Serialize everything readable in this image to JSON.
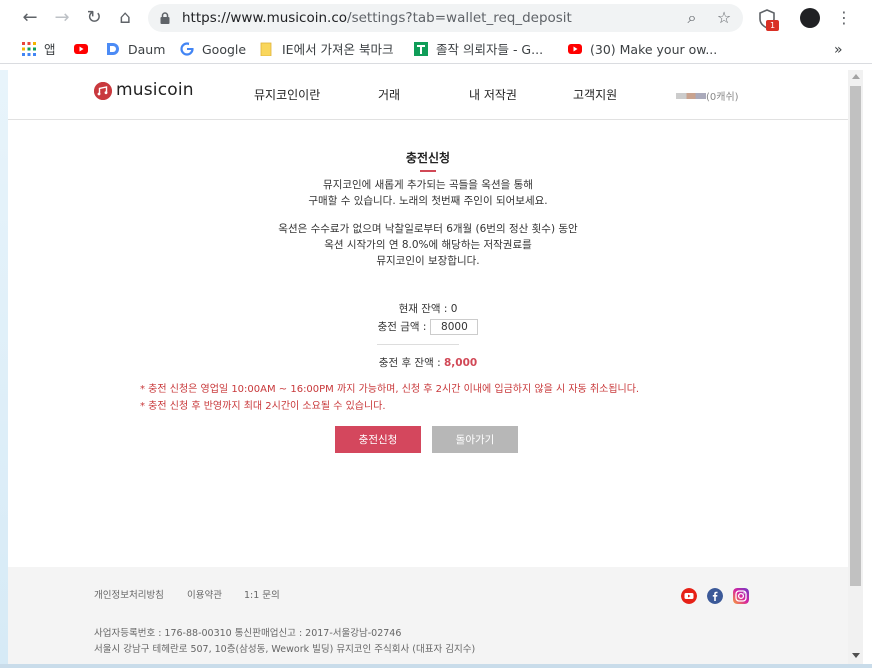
{
  "browser": {
    "url_host": "https://www.musicoin.co",
    "url_path": "/settings?tab=wallet_req_deposit",
    "extension_badge": "1",
    "bookmarks": [
      {
        "label": "앱"
      },
      {
        "label": ""
      },
      {
        "label": "Daum"
      },
      {
        "label": "Google"
      },
      {
        "label": "IE에서 가져온 북마크"
      },
      {
        "label": "졸작 의뢰자들 - G..."
      },
      {
        "label": "(30) Make your ow..."
      }
    ],
    "more_bookmarks": "»"
  },
  "site": {
    "logo_text": "musicoin",
    "nav": [
      "뮤지코인이란",
      "거래",
      "내 저작권",
      "고객지원"
    ],
    "cash_label": "(0캐쉬)"
  },
  "deposit": {
    "title": "충전신청",
    "desc1": [
      "뮤지코인에 새롭게 추가되는 곡들을 옥션을 통해",
      "구매할 수 있습니다. 노래의 첫번째 주인이 되어보세요."
    ],
    "desc2": [
      "옥션은 수수료가 없으며 낙찰일로부터 6개월 (6번의 정산 횟수) 동안",
      "옥션 시작가의 연 8.0%에 해당하는 저작권료를",
      "뮤지코인이 보장합니다."
    ],
    "balance_label": "현재 잔액 : 0",
    "amount_label": "충전 금액 :",
    "amount_value": "8000",
    "after_label": "충전 후 잔액 : ",
    "after_value": "8,000",
    "notice1": "* 충전 신청은 영업일 10:00AM ~ 16:00PM 까지 가능하며, 신청 후 2시간 이내에 입금하지 않을 시 자동 취소됩니다.",
    "notice2": "* 충전 신청 후 반영까지 최대 2시간이 소요될 수 있습니다.",
    "submit_label": "충전신청",
    "back_label": "돌아가기"
  },
  "footer": {
    "links": [
      "개인정보처리방침",
      "이용약관",
      "1:1 문의"
    ],
    "info1": "사업자등록번호 : 176-88-00310    통신판매업신고 : 2017-서울강남-02746",
    "info2": "서울시 강남구 테헤란로 507, 10층(삼성동, Wework 빌딩) 뮤지코인 주식회사 (대표자 김지수)"
  },
  "colors": {
    "accent": "#d4475d",
    "secondary_button": "#b7b7b7",
    "notice": "#c8383a"
  }
}
